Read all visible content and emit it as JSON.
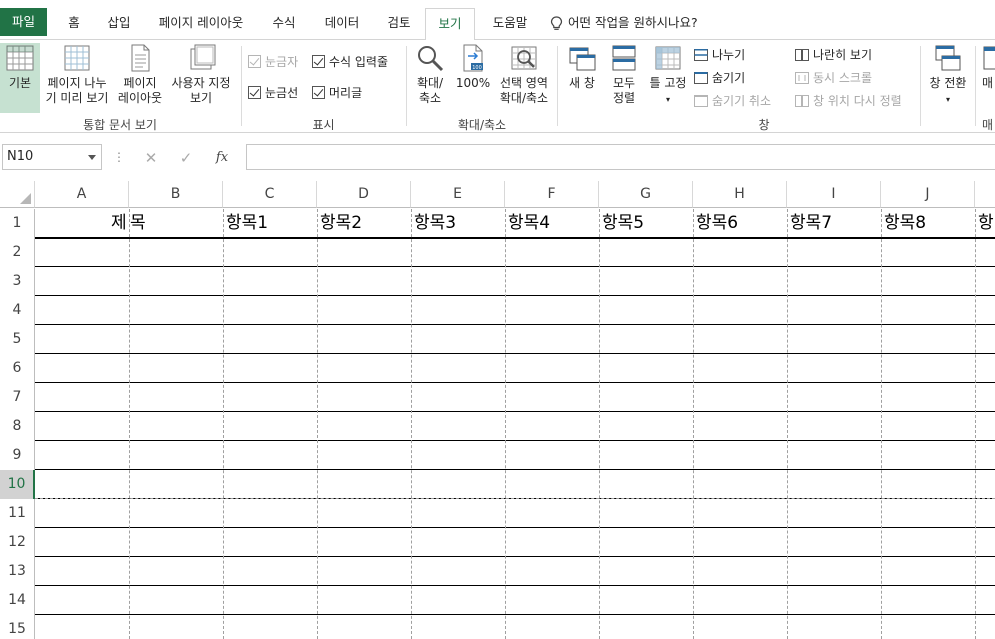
{
  "tabs": {
    "file": "파일",
    "home": "홈",
    "insert": "삽입",
    "page_layout": "페이지 레이아웃",
    "formulas": "수식",
    "data": "데이터",
    "review": "검토",
    "view": "보기",
    "help": "도움말",
    "tell_me": "어떤 작업을 원하시나요?"
  },
  "ribbon": {
    "workbook_views": {
      "label": "통합 문서 보기",
      "normal": "기본",
      "page_break_line1": "페이지 나누",
      "page_break_line2": "기 미리 보기",
      "page_layout_line1": "페이지",
      "page_layout_line2": "레이아웃",
      "custom_line1": "사용자 지정",
      "custom_line2": "보기"
    },
    "show": {
      "label": "표시",
      "ruler": "눈금자",
      "formula_bar": "수식 입력줄",
      "gridlines": "눈금선",
      "headings": "머리글"
    },
    "zoom": {
      "label": "확대/축소",
      "zoom_line1": "확대/",
      "zoom_line2": "축소",
      "hundred": "100%",
      "selection_line1": "선택 영역",
      "selection_line2": "확대/축소"
    },
    "window": {
      "label": "창",
      "new_window": "새 창",
      "arrange_line1": "모두",
      "arrange_line2": "정렬",
      "freeze": "틀 고정",
      "split": "나누기",
      "hide": "숨기기",
      "unhide": "숨기기 취소",
      "side_by_side": "나란히 보기",
      "sync_scroll": "동시 스크롤",
      "reset_position": "창 위치 다시 정렬",
      "switch": "창 전환",
      "macros_cut": "매"
    }
  },
  "formula_bar": {
    "name_box": "N10",
    "fx": "fx"
  },
  "grid": {
    "columns": [
      "A",
      "B",
      "C",
      "D",
      "E",
      "F",
      "G",
      "H",
      "I",
      "J"
    ],
    "rows": [
      "1",
      "2",
      "3",
      "4",
      "5",
      "6",
      "7",
      "8",
      "9",
      "10",
      "11",
      "12",
      "13",
      "14",
      "15"
    ],
    "row1": {
      "title_a": "제",
      "title_b": "목",
      "items": [
        "항목1",
        "항목2",
        "항목3",
        "항목4",
        "항목5",
        "항목6",
        "항목7",
        "항목8",
        "항"
      ]
    },
    "selected_row": "10"
  },
  "colors": {
    "accent": "#217346",
    "selected_view": "#c6e1d1"
  }
}
